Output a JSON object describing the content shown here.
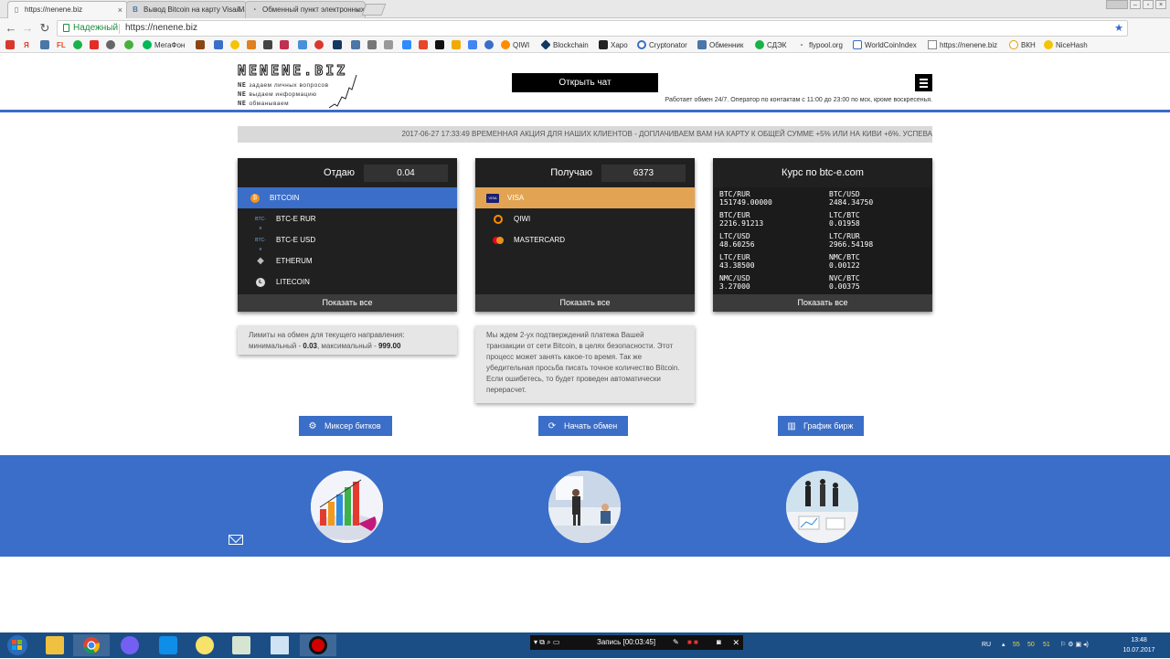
{
  "browser": {
    "tabs": [
      {
        "title": "https://nenene.biz",
        "active": true
      },
      {
        "title": "Вывод Bitcoin на карту Visa/MasterCard",
        "active": false
      },
      {
        "title": "Обменный пункт электронных валют",
        "active": false
      }
    ],
    "address": {
      "security_label": "Надежный",
      "url": "https://nenene.biz"
    },
    "bookmarks": [
      {
        "label": "МегаФон",
        "icon": "megafon-icon",
        "color": "#00b956"
      },
      {
        "label": "QIWI",
        "icon": "qiwi-icon",
        "color": "#ff8c00"
      },
      {
        "label": "Blockchain",
        "icon": "blockchain-icon",
        "color": "#123962"
      },
      {
        "label": "Харо",
        "icon": "xapo-icon",
        "color": "#222222"
      },
      {
        "label": "Cryptonator",
        "icon": "cryptonator-icon",
        "color": "#3a6ec8"
      },
      {
        "label": "Обменник",
        "icon": "vk-icon",
        "color": "#4a76a8"
      },
      {
        "label": "СДЭК",
        "icon": "cdek-icon",
        "color": "#1ab248"
      },
      {
        "label": "flypool.org",
        "icon": "flypool-icon",
        "color": "#555555"
      },
      {
        "label": "WorldCoinIndex",
        "icon": "worldcoinindex-icon",
        "color": "#3a6ec8"
      },
      {
        "label": "https://nenene.biz",
        "icon": "page-icon",
        "color": "#888888"
      },
      {
        "label": "ВКН",
        "icon": "vkn-icon",
        "color": "#e0a000"
      },
      {
        "label": "NiceHash",
        "icon": "nicehash-icon",
        "color": "#f5c400"
      }
    ]
  },
  "site": {
    "logo": {
      "name": "NENENE.BIZ",
      "lines": [
        "задаем личных вопросов",
        "выдаем информацию",
        "обманываем"
      ],
      "prefix": "NE"
    },
    "chat_button": "Открыть чат",
    "work_hours": "Работает обмен 24/7. Оператор по контактам с 11:00 до 23:00 по мск, кроме воскресенья.",
    "ticker": "2017-06-27 17:33:49   ВРЕМЕННАЯ АКЦИЯ ДЛЯ НАШИХ КЛИЕНТОВ - ДОПЛАЧИВАЕМ ВАМ НА КАРТУ К ОБЩЕЙ СУММЕ +5% ИЛИ НА КИВИ +6%. УСПЕВА",
    "give": {
      "label": "Отдаю",
      "amount": "0.04",
      "items": [
        {
          "name": "BITCOIN",
          "icon": "bitcoin-icon",
          "selected": true
        },
        {
          "name": "BTC-E RUR",
          "icon": "btce-icon",
          "selected": false
        },
        {
          "name": "BTC-E USD",
          "icon": "btce-icon",
          "selected": false
        },
        {
          "name": "ETHERUM",
          "icon": "ethereum-icon",
          "selected": false
        },
        {
          "name": "LITECOIN",
          "icon": "litecoin-icon",
          "selected": false
        }
      ],
      "show_all": "Показать все"
    },
    "receive": {
      "label": "Получаю",
      "amount": "6373",
      "items": [
        {
          "name": "VISA",
          "icon": "visa-icon",
          "selected": true
        },
        {
          "name": "QIWI",
          "icon": "qiwi-icon",
          "selected": false
        },
        {
          "name": "MASTERCARD",
          "icon": "mastercard-icon",
          "selected": false
        }
      ],
      "show_all": "Показать все"
    },
    "rates": {
      "title": "Курс по btc-e.com",
      "pairs": [
        {
          "pair": "BTC/RUR",
          "value": "151749.00000"
        },
        {
          "pair": "BTC/USD",
          "value": "2484.34750"
        },
        {
          "pair": "BTC/EUR",
          "value": "2216.91213"
        },
        {
          "pair": "LTC/BTC",
          "value": "0.01958"
        },
        {
          "pair": "LTC/USD",
          "value": "48.60256"
        },
        {
          "pair": "LTC/RUR",
          "value": "2966.54198"
        },
        {
          "pair": "LTC/EUR",
          "value": "43.38500"
        },
        {
          "pair": "NMC/BTC",
          "value": "0.00122"
        },
        {
          "pair": "NMC/USD",
          "value": "3.27000"
        },
        {
          "pair": "NVC/BTC",
          "value": "0.00375"
        }
      ],
      "show_all": "Показать все"
    },
    "limits": {
      "text": "Лимиты на обмен для текущего направления:",
      "min_label": "минимальный -",
      "min": "0.03",
      "max_label": ", максимальный -",
      "max": "999.00"
    },
    "confirm_notice": "Мы ждем 2-ух подтверждений платежа Вашей транзакции от сети Bitcoin, в целях безопасности. Этот процесс может занять какое-то время. Так же убедительная просьба писать точное количество Bitcoin. Если ошибетесь, то будет проведен автоматически перерасчет.",
    "actions": {
      "mixer": "Миксер битков",
      "start": "Начать обмен",
      "chart": "График бирж"
    }
  },
  "taskbar": {
    "recorder_label": "Запись [00:03:45]",
    "lang": "RU",
    "tray_numbers": [
      "55",
      "50",
      "51"
    ],
    "time": "13:48",
    "date": "10.07.2017"
  },
  "colors": {
    "accent": "#3a6ec8",
    "visa_selected": "#e2a453",
    "card_bg": "#202020"
  }
}
